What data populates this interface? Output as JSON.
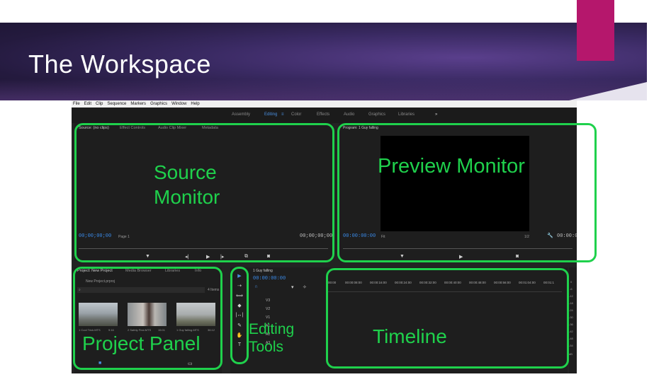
{
  "slide": {
    "title": "The Workspace",
    "colors": {
      "accent": "#b5176c",
      "annotation": "#1fd14c",
      "banner": "#2a1f48"
    }
  },
  "app": {
    "menu": [
      "File",
      "Edit",
      "Clip",
      "Sequence",
      "Markers",
      "Graphics",
      "Window",
      "Help"
    ],
    "workspaces": [
      "Assembly",
      "Editing",
      "Color",
      "Effects",
      "Audio",
      "Graphics",
      "Libraries"
    ],
    "active_workspace": "Editing",
    "workspace_more": "»"
  },
  "source_panel": {
    "tabs": [
      "Source: (no clips)",
      "Effect Controls",
      "Audio Clip Mixer",
      "Metadata"
    ],
    "timecode_left": "00;00;00;00",
    "timecode_right": "00;00;00;00",
    "page": "Page 1"
  },
  "program_panel": {
    "tab": "Program: 1 Guy falling",
    "timecode_left": "00:00:00:00",
    "fit": "Fit",
    "quality": "1/2",
    "timecode_right": "00:00:00:00"
  },
  "project_panel": {
    "tabs": [
      "Project: New Project",
      "Media Browser",
      "Libraries",
      "Info"
    ],
    "project_file": "New Project.prproj",
    "items_count": "4 Items",
    "clips": [
      {
        "name": "1 Cool Trick.MTS",
        "duration": "9:16"
      },
      {
        "name": "2 Safety First.MTS",
        "duration": "15:01"
      },
      {
        "name": "1 Guy falling.MTS",
        "duration": "36:12"
      }
    ]
  },
  "timeline_panel": {
    "tab": "1 Guy falling",
    "timecode": "00:00:00:00",
    "video_tracks": [
      "V3",
      "V2",
      "V1"
    ],
    "audio_tracks": [
      "A1",
      "A2",
      "A3"
    ],
    "ruler": [
      "00:00",
      "00:00:08:00",
      "00:00:16:00",
      "00:00:24:00",
      "00:00:32:00",
      "00:00:40:00",
      "00:00:48:00",
      "00:00:56:00",
      "00:01:04:00",
      "00:01:1"
    ]
  },
  "meters": [
    "0",
    "-6",
    "-12",
    "-18",
    "-24",
    "-30",
    "-36",
    "-42",
    "-48",
    "-54",
    "dB"
  ],
  "annotations": {
    "source": [
      "Source",
      "Monitor"
    ],
    "preview": "Preview Monitor",
    "project": "Project Panel",
    "tools": [
      "Editing",
      "Tools"
    ],
    "timeline": "Timeline"
  },
  "icons": {
    "tools": [
      "selection-icon",
      "track-select-icon",
      "ripple-edit-icon",
      "razor-icon",
      "slip-icon",
      "pen-icon",
      "hand-icon",
      "type-icon"
    ]
  }
}
